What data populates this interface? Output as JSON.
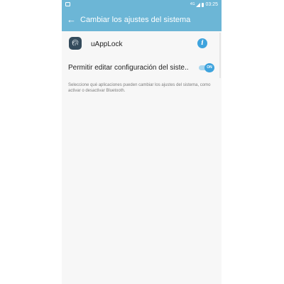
{
  "status_bar": {
    "network_label": "4G",
    "time": "03:25"
  },
  "app_bar": {
    "back_icon": "arrow-left-icon",
    "title": "Cambiar los ajustes del sistema"
  },
  "app": {
    "icon": "fingerprint-icon",
    "name": "uAppLock",
    "info_icon": "info-icon"
  },
  "setting": {
    "label": "Permitir editar configuración del siste..",
    "toggle_state": "ON",
    "enabled": true
  },
  "description": "Seleccione qué aplicaciones pueden cambiar los ajustes del sistema, como activar o desactivar Bluetooth.",
  "colors": {
    "app_bar": "#6cb6d6",
    "accent": "#3ea3dd",
    "background": "#f7f7f7"
  }
}
